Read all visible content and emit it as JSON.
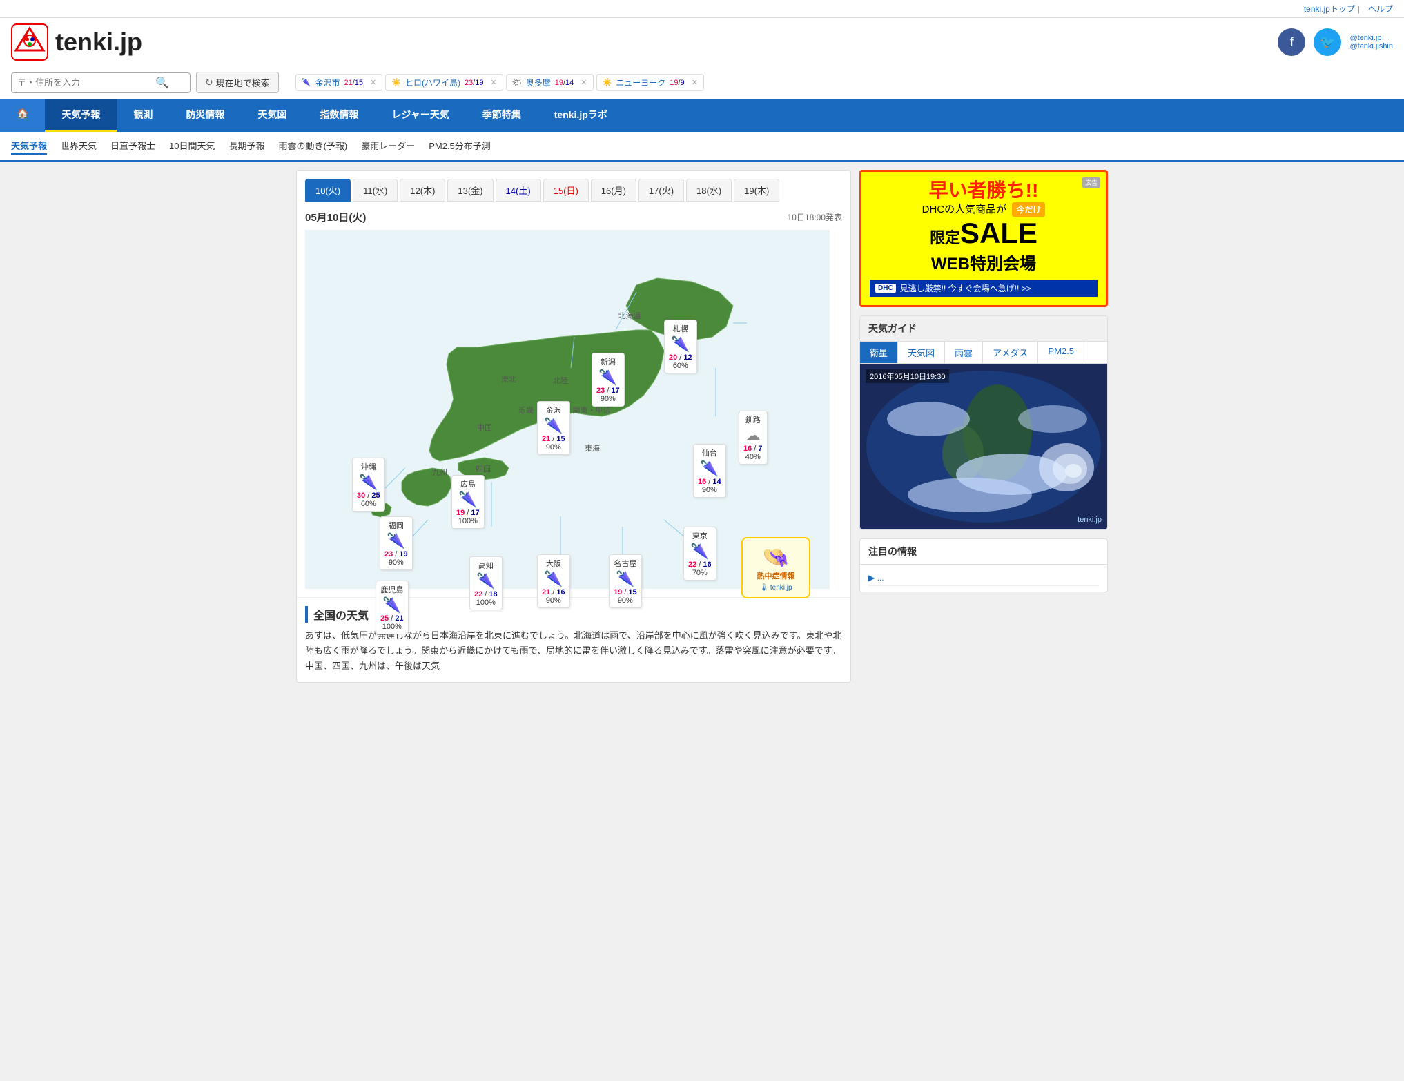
{
  "site": {
    "name": "tenki.jp",
    "topLink": "tenki.jpトップ",
    "helpLink": "ヘルプ",
    "twitter": "@tenki.jp",
    "twitter2": "@tenki.jishin"
  },
  "search": {
    "placeholder": "〒・住所を入力",
    "locationBtn": "現在地で検索"
  },
  "chips": [
    {
      "city": "金沢市",
      "high": "21",
      "low": "15",
      "icon": "🌂"
    },
    {
      "city": "ヒロ(ハワイ島)",
      "high": "23",
      "low": "19",
      "icon": "☀️"
    },
    {
      "city": "奥多摩",
      "high": "19",
      "low": "14",
      "icon": "🌤"
    },
    {
      "city": "ニューヨーク",
      "high": "19",
      "low": "9",
      "icon": "☀️"
    }
  ],
  "nav": {
    "items": [
      {
        "label": "天気予報",
        "active": true
      },
      {
        "label": "観測"
      },
      {
        "label": "防災情報"
      },
      {
        "label": "天気図"
      },
      {
        "label": "指数情報"
      },
      {
        "label": "レジャー天気"
      },
      {
        "label": "季節特集"
      },
      {
        "label": "tenki.jpラボ"
      }
    ]
  },
  "subNav": {
    "items": [
      {
        "label": "天気予報",
        "active": true
      },
      {
        "label": "世界天気"
      },
      {
        "label": "日直予報士"
      },
      {
        "label": "10日間天気"
      },
      {
        "label": "長期予報"
      },
      {
        "label": "雨雲の動き(予報)"
      },
      {
        "label": "豪雨レーダー"
      },
      {
        "label": "PM2.5分布予測"
      }
    ]
  },
  "dateTabs": [
    {
      "label": "10(火)",
      "active": true,
      "type": "weekday"
    },
    {
      "label": "11(水)",
      "type": "weekday"
    },
    {
      "label": "12(木)",
      "type": "weekday"
    },
    {
      "label": "13(金)",
      "type": "weekday"
    },
    {
      "label": "14(土)",
      "type": "sat"
    },
    {
      "label": "15(日)",
      "type": "sun"
    },
    {
      "label": "16(月)",
      "type": "weekday"
    },
    {
      "label": "17(火)",
      "type": "weekday"
    },
    {
      "label": "18(水)",
      "type": "weekday"
    },
    {
      "label": "19(木)",
      "type": "weekday"
    }
  ],
  "mapDate": "05月10日(火)",
  "mapTime": "10日18:00発表",
  "regions": [
    {
      "name": "沖縄",
      "icon": "🌂",
      "high": "30",
      "low": "25",
      "rain": "60%",
      "left": "80",
      "top": "340"
    },
    {
      "name": "広島",
      "icon": "🌂",
      "high": "19",
      "low": "17",
      "rain": "100%",
      "left": "216",
      "top": "380"
    },
    {
      "name": "金沢",
      "icon": "🌂",
      "high": "21",
      "low": "15",
      "rain": "90%",
      "left": "340",
      "top": "290"
    },
    {
      "name": "新潟",
      "icon": "🌂",
      "high": "23",
      "low": "17",
      "rain": "90%",
      "left": "420",
      "top": "230"
    },
    {
      "name": "札幌",
      "icon": "🌂",
      "high": "20",
      "low": "12",
      "rain": "60%",
      "left": "535",
      "top": "175"
    },
    {
      "name": "釧路",
      "icon": "☁",
      "high": "16",
      "low": "7",
      "rain": "40%",
      "left": "630",
      "top": "295"
    },
    {
      "name": "仙台",
      "icon": "🌂",
      "high": "16",
      "low": "14",
      "rain": "90%",
      "left": "573",
      "top": "345"
    },
    {
      "name": "東京",
      "icon": "🌂",
      "high": "22",
      "low": "16",
      "rain": "70%",
      "left": "553",
      "top": "480"
    },
    {
      "name": "名古屋",
      "icon": "🌂",
      "high": "19",
      "low": "15",
      "rain": "90%",
      "left": "448",
      "top": "510"
    },
    {
      "name": "大阪",
      "icon": "🌂",
      "high": "21",
      "low": "16",
      "rain": "90%",
      "left": "348",
      "top": "510"
    },
    {
      "name": "高知",
      "icon": "🌂",
      "high": "22",
      "low": "18",
      "rain": "100%",
      "left": "246",
      "top": "520"
    },
    {
      "name": "福岡",
      "icon": "🌂",
      "high": "23",
      "low": "19",
      "rain": "90%",
      "left": "122",
      "top": "470"
    },
    {
      "name": "鹿児島",
      "icon": "🌂",
      "high": "25",
      "low": "21",
      "rain": "100%",
      "left": "114",
      "top": "560"
    }
  ],
  "news": {
    "title": "全国の天気",
    "text": "あすは、低気圧が発達しながら日本海沿岸を北東に進むでしょう。北海道は雨で、沿岸部を中心に風が強く吹く見込みです。東北や北陸も広く雨が降るでしょう。関東から近畿にかけても雨で、局地的に雷を伴い激しく降る見込みです。落雷や突風に注意が必要です。中国、四国、九州は、午後は天気"
  },
  "ad": {
    "title1": "早い者勝ち!!",
    "title2": "DHCの人気商品が",
    "imaake": "今だけ",
    "sale": "限定SALE",
    "web": "WEB特別会場",
    "dhc_text": "DHC 見逃し厳禁!! 今すぐ会場へ急げ!! >>"
  },
  "guide": {
    "title": "天気ガイド",
    "tabs": [
      "衛星",
      "天気図",
      "雨雲",
      "アメダス",
      "PM2.5"
    ],
    "activeTab": 0,
    "timestamp": "2016年05月10日19:30"
  },
  "infoBox": {
    "title": "注目の情報"
  }
}
